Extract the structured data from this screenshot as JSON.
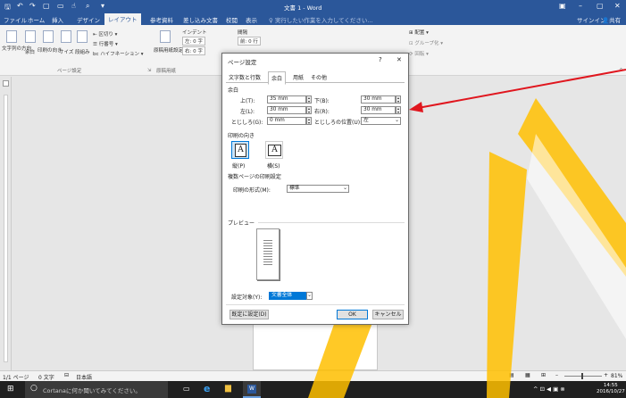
{
  "title": "文書 1 - Word",
  "colors": {
    "accent": "#2b579a",
    "arrow": "#e0161e",
    "watermark": "#ffc000"
  },
  "quick_access": [
    "save-icon",
    "undo-icon",
    "redo-icon",
    "new-doc-icon",
    "open-icon",
    "touch-mode-icon",
    "print-preview-icon",
    "customize-icon"
  ],
  "tabs": [
    "ファイル",
    "ホーム",
    "挿入",
    "デザイン",
    "レイアウト",
    "参考資料",
    "差し込み文書",
    "校閲",
    "表示"
  ],
  "active_tab": "レイアウト",
  "tell_me": "♀ 実行したい作業を入力してください...",
  "signin": "サインイン",
  "share": "共有",
  "ribbon": {
    "text_direction": "文字列の方向",
    "margins": "余白",
    "orientation": "印刷の向き",
    "size": "サイズ",
    "columns": "段組み",
    "breaks": "区切り",
    "line_numbers": "行番号",
    "hyphenation": "ハイフネーション",
    "group_page_setup": "ページ設定",
    "manuscript": "原稿用紙設定",
    "group_manuscript": "原稿用紙",
    "indent": "インデント",
    "spacing": "間隔",
    "indent_left": "左: 0 字",
    "indent_right": "右: 0 字",
    "spacing_before": "前: 0 行",
    "position": "配置",
    "group": "グループ化",
    "rotate": "回転"
  },
  "dialog": {
    "title": "ページ設定",
    "help": "?",
    "close": "✕",
    "tabs": [
      "文字数と行数",
      "余白",
      "用紙",
      "その他"
    ],
    "active_tab": "余白",
    "margins_section": "余白",
    "top_label": "上(T):",
    "top_value": "35 mm",
    "bottom_label": "下(B):",
    "bottom_value": "30 mm",
    "left_label": "左(L):",
    "left_value": "30 mm",
    "right_label": "右(R):",
    "right_value": "30 mm",
    "gutter_label": "とじしろ(G):",
    "gutter_value": "0 mm",
    "gutter_pos_label": "とじしろの位置(U):",
    "gutter_pos_value": "左",
    "orientation_section": "印刷の向き",
    "portrait_label": "縦(P)",
    "landscape_label": "横(S)",
    "multipage_section": "複数ページの印刷設定",
    "print_format_label": "印刷の形式(M):",
    "print_format_value": "標準",
    "preview_section": "プレビュー",
    "apply_to_label": "設定対象(Y):",
    "apply_to_value": "文書全体",
    "default_button": "既定に設定(D)",
    "ok_button": "OK",
    "cancel_button": "キャンセル"
  },
  "status": {
    "page": "1/1 ページ",
    "words": "0 文字",
    "language": "日本語",
    "zoom": "81%"
  },
  "taskbar": {
    "cortana": "Cortanaに何か聞いてみてください。",
    "time": "14:55",
    "date": "2016/10/27"
  }
}
